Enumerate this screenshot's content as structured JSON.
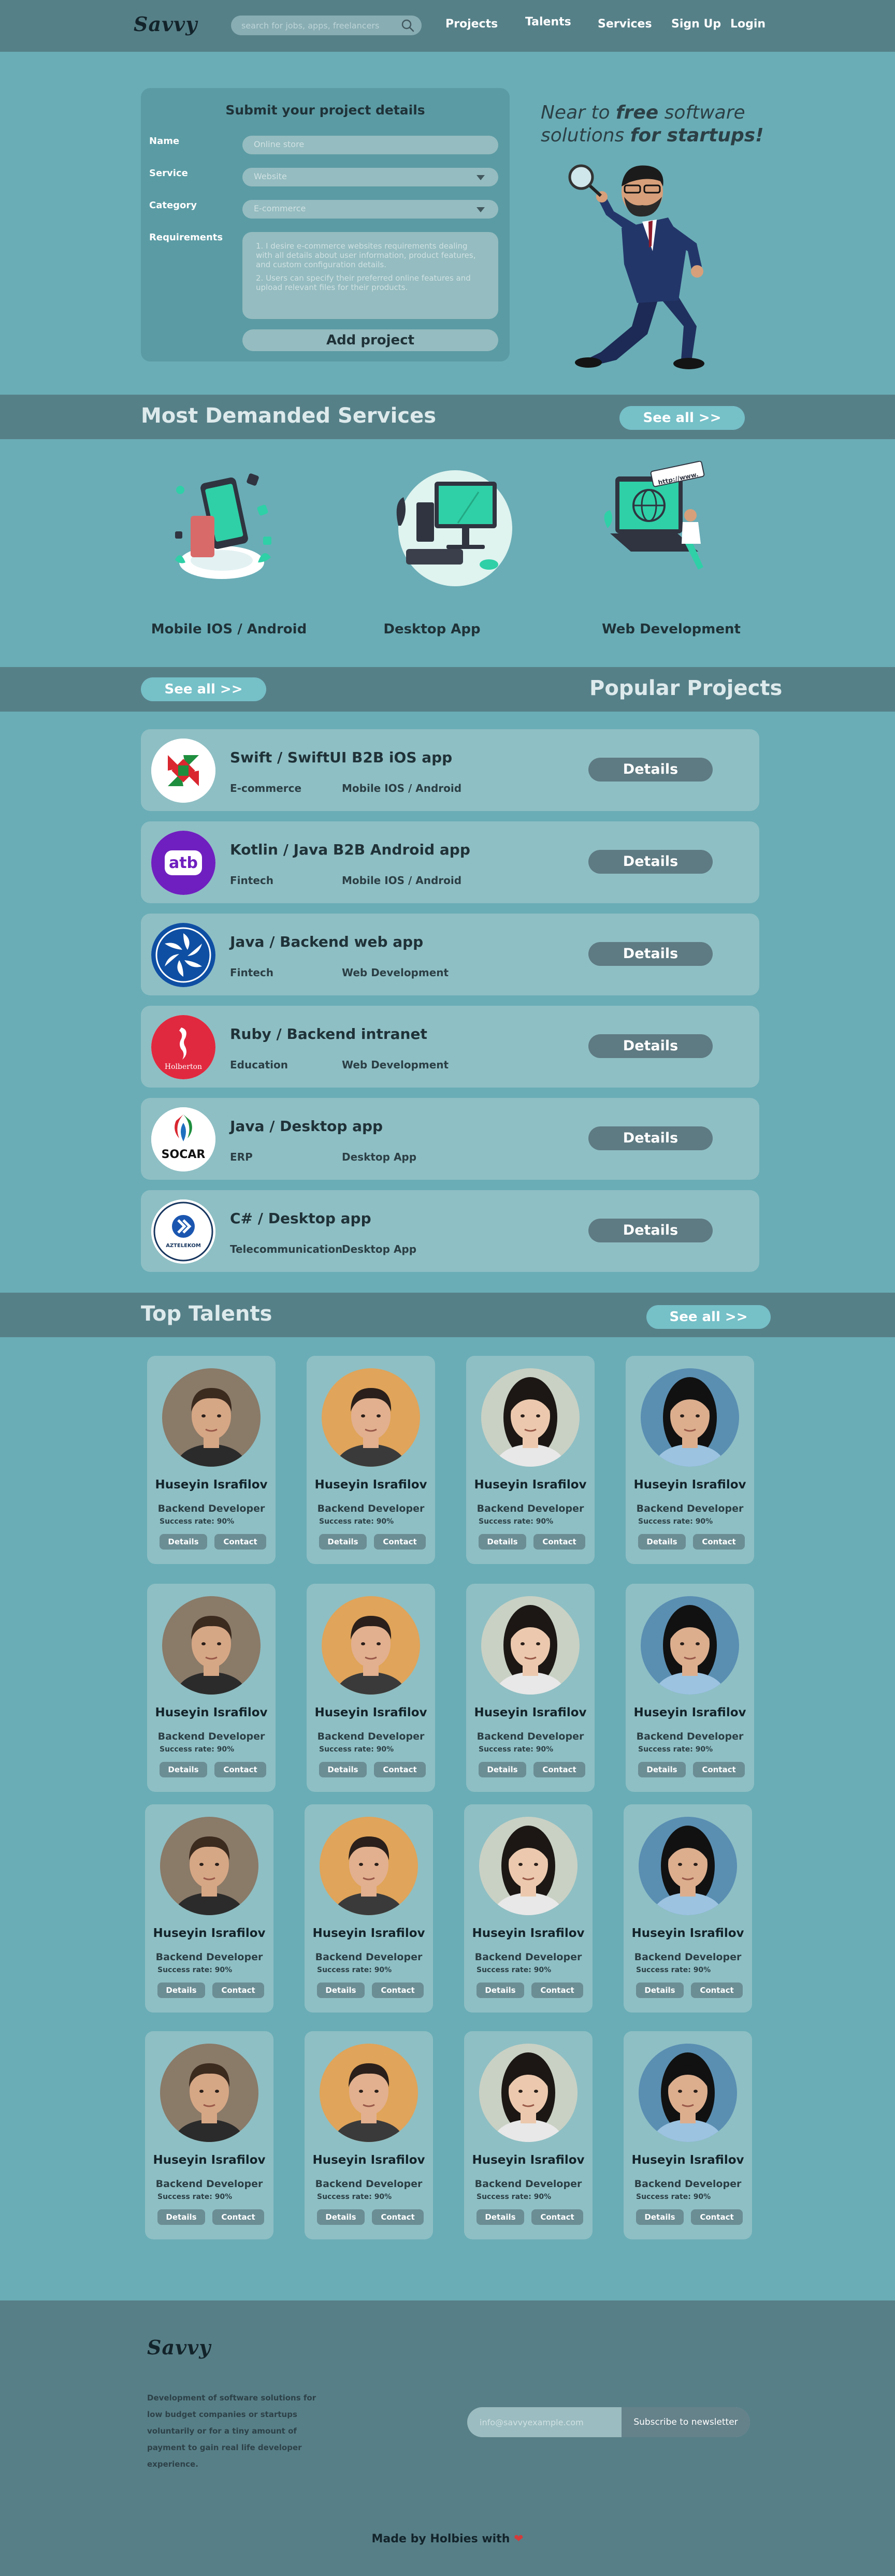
{
  "nav": {
    "logo": "Savvy",
    "search_placeholder": "search for jobs, apps, freelancers",
    "links": [
      "Projects",
      "Talents",
      "Services",
      "Sign Up",
      "Login"
    ]
  },
  "form": {
    "title": "Submit your project details",
    "name_label": "Name",
    "name_placeholder": "Online store",
    "service_label": "Service",
    "service_value": "Website",
    "category_label": "Category",
    "category_value": "E-commerce",
    "requirements_label": "Requirements",
    "requirements_lines": [
      "1. I desire e-commerce websites requirements dealing with all details about user information, product features, and custom configuration details.",
      "2. Users can specify their preferred online features and upload relevant files for their products."
    ],
    "submit_label": "Add project"
  },
  "hero": {
    "tagline_1a": "Near to ",
    "tagline_1b": "free",
    "tagline_1c": " software",
    "tagline_2a": "solutions ",
    "tagline_2b": "for startups!"
  },
  "services": {
    "title": "Most Demanded Services",
    "see_all": "See all >>",
    "items": [
      {
        "label": "Mobile IOS / Android"
      },
      {
        "label": "Desktop App"
      },
      {
        "label": "Web Development"
      }
    ]
  },
  "projects": {
    "title": "Popular Projects",
    "see_all": "See all >>",
    "details_label": "Details",
    "items": [
      {
        "title": "Swift / SwiftUI B2B iOS app",
        "category": "E-commerce",
        "type": "Mobile IOS / Android",
        "logo_text": ""
      },
      {
        "title": "Kotlin / Java B2B Android app",
        "category": "Fintech",
        "type": "Mobile IOS / Android",
        "logo_text": "atb"
      },
      {
        "title": "Java / Backend web app",
        "category": "Fintech",
        "type": "Web Development",
        "logo_text": ""
      },
      {
        "title": "Ruby / Backend intranet",
        "category": "Education",
        "type": "Web Development",
        "logo_text": "Holberton"
      },
      {
        "title": "Java / Desktop app",
        "category": "ERP",
        "type": "Desktop App",
        "logo_text": "SOCAR"
      },
      {
        "title": "C# / Desktop app",
        "category": "Telecommunication",
        "type": "Desktop App",
        "logo_text": "AZTELEKOM"
      }
    ]
  },
  "talents": {
    "title": "Top Talents",
    "see_all": "See all >>",
    "name": "Huseyin Israfilov",
    "role": "Backend Developer",
    "rate": "Success rate: 90%",
    "details_label": "Details",
    "contact_label": "Contact"
  },
  "footer": {
    "logo": "Savvy",
    "description": "Development of software solutions for low budget companies or startups voluntarily or for a tiny amount of payment to gain real life developer experience.",
    "email_placeholder": "info@savvyexample.com",
    "subscribe_label": "Subscribe to newsletter",
    "made_by": "Made by Holbies with",
    "heart": "❤"
  },
  "colors": {
    "page_bg": "#6aadb6",
    "band_bg": "#568088",
    "card_bg": "#8ebfc4",
    "button_dark": "#5e7a82",
    "accent_pill": "#76c0c8"
  }
}
